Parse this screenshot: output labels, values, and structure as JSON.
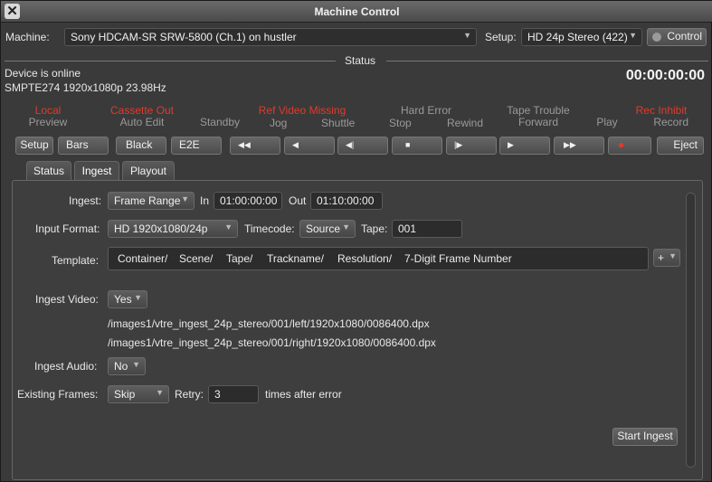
{
  "window": {
    "title": "Machine Control",
    "close_glyph": "✕"
  },
  "machine": {
    "label": "Machine:",
    "value": "Sony HDCAM-SR SRW-5800 (Ch.1) on hustler"
  },
  "setup": {
    "label": "Setup:",
    "value": "HD 24p Stereo (422)",
    "control_label": "Control"
  },
  "status": {
    "heading": "Status",
    "device": "Device is online",
    "format": "SMPTE274 1920x1080p 23.98Hz",
    "timecode": "00:00:00:00"
  },
  "indicators": [
    {
      "top": "Local",
      "bottom": "Preview"
    },
    {
      "top": "Cassette Out",
      "bottom": "Auto Edit"
    },
    {
      "top": "",
      "bottom": "Standby"
    },
    {
      "top": "Ref Video Missing",
      "bottom": "Jog",
      "bottom2": "Shuttle"
    },
    {
      "top": "Hard Error",
      "bottom": "Stop",
      "bottom2": "Rewind"
    },
    {
      "top": "Tape Trouble",
      "bottom": "Forward"
    },
    {
      "top": "",
      "bottom": "Play"
    },
    {
      "top": "Rec Inhibit",
      "bottom": "Record"
    }
  ],
  "transport": {
    "setup": "Setup",
    "bars": "Bars",
    "black": "Black",
    "e2e": "E2E",
    "rewind": "◀◀",
    "prev": "◀",
    "step_back": "◀|",
    "stop": "■",
    "step_fwd": "|▶",
    "play": "▶",
    "ffwd": "▶▶",
    "record": "●",
    "eject": "Eject"
  },
  "tabs": [
    "Status",
    "Ingest",
    "Playout"
  ],
  "ingest": {
    "ingest_label": "Ingest:",
    "ingest_value": "Frame Range",
    "in_label": "In",
    "in_value": "01:00:00:00",
    "out_label": "Out",
    "out_value": "01:10:00:00",
    "input_format_label": "Input Format:",
    "input_format_value": "HD 1920x1080/24p",
    "timecode_label": "Timecode:",
    "timecode_value": "Source",
    "tape_label": "Tape:",
    "tape_value": "001",
    "template_label": "Template:",
    "template_tokens": [
      "Container/",
      "Scene/",
      "Tape/",
      "Trackname/",
      "Resolution/",
      "7-Digit Frame Number"
    ],
    "template_add": "+",
    "ingest_video_label": "Ingest Video:",
    "ingest_video_value": "Yes",
    "path_left": "/images1/vtre_ingest_24p_stereo/001/left/1920x1080/0086400.dpx",
    "path_right": "/images1/vtre_ingest_24p_stereo/001/right/1920x1080/0086400.dpx",
    "ingest_audio_label": "Ingest Audio:",
    "ingest_audio_value": "No",
    "existing_frames_label": "Existing Frames:",
    "existing_frames_value": "Skip",
    "retry_label": "Retry:",
    "retry_value": "3",
    "retry_suffix": "times after error",
    "start_button": "Start Ingest"
  }
}
